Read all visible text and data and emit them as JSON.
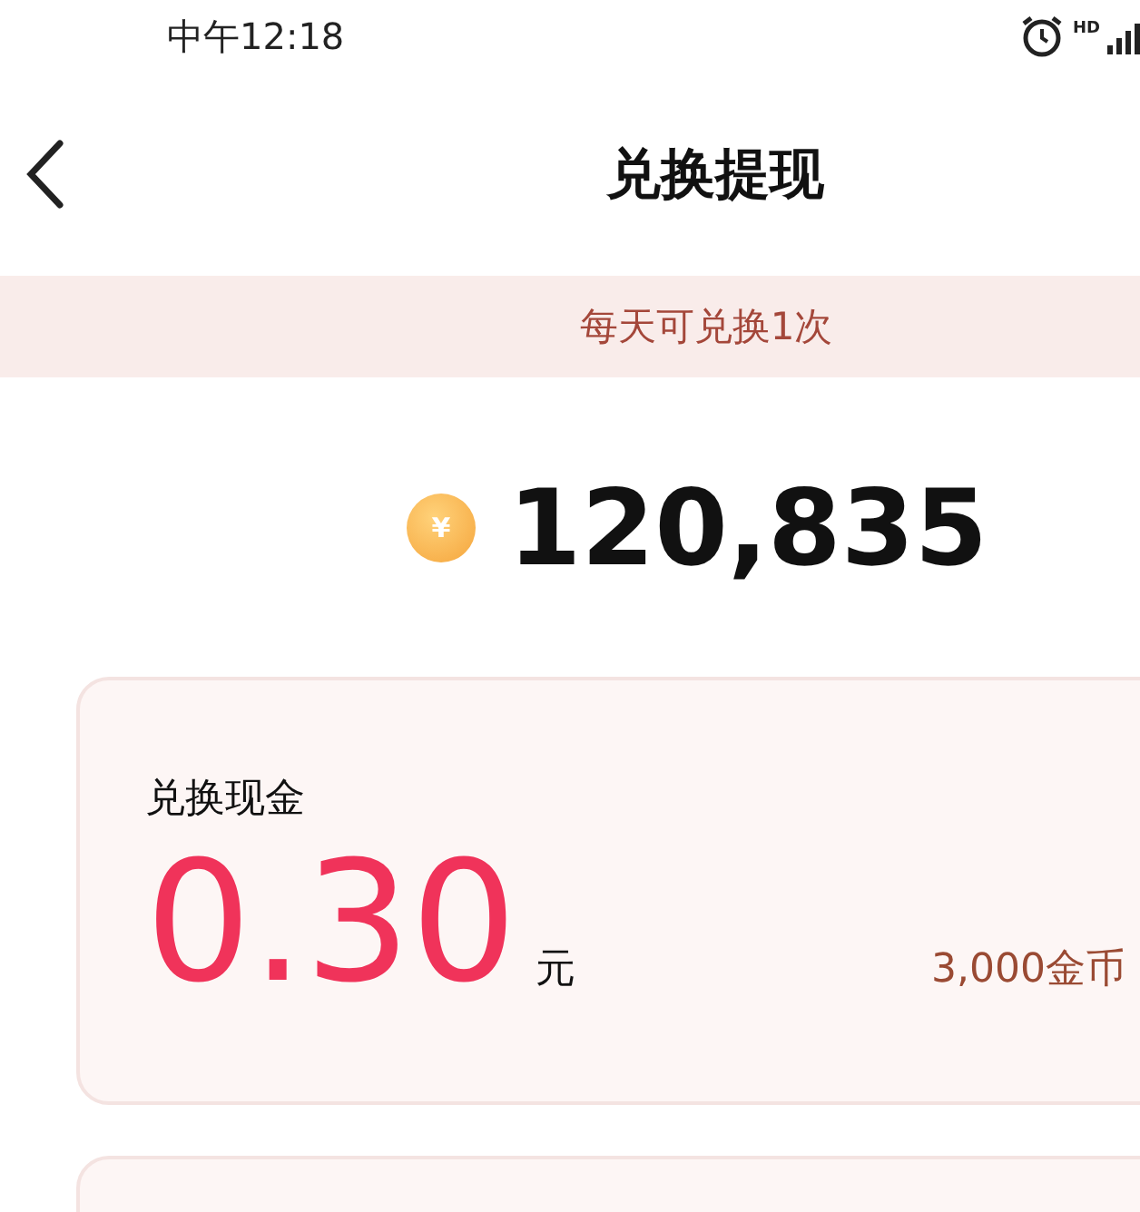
{
  "status_bar": {
    "time": "中午12:18",
    "network": "HD"
  },
  "nav": {
    "title": "兑换提现"
  },
  "notice": "每天可兑换1次",
  "balance": {
    "amount": "120,835",
    "coin_symbol": "¥"
  },
  "cards": [
    {
      "kind": "full",
      "label": "兑换现金",
      "amount": "0.30",
      "unit": "元",
      "cost": "3,000金币"
    },
    {
      "kind": "cut"
    }
  ]
}
